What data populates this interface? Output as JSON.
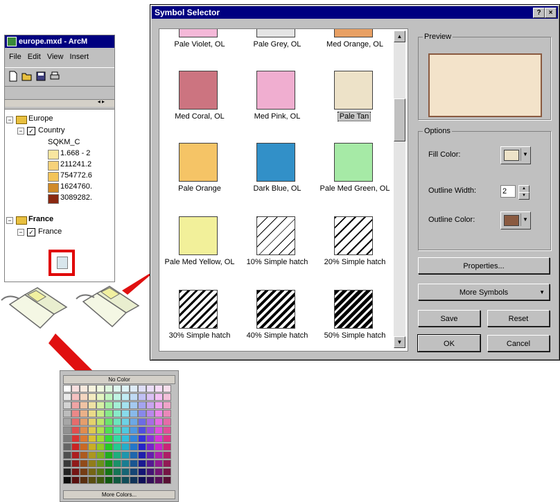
{
  "arcmap": {
    "title": "europe.mxd - ArcM",
    "menu": [
      "File",
      "Edit",
      "View",
      "Insert"
    ],
    "toc": {
      "group1": "Europe",
      "layer1": "Country",
      "field": "SQKM_C",
      "classes": [
        {
          "label": "1.668 - 2",
          "color": "#f9e6a0"
        },
        {
          "label": "211241.2",
          "color": "#f7d27a"
        },
        {
          "label": "754772.6",
          "color": "#f3c45a"
        },
        {
          "label": "1624760.",
          "color": "#d08a28"
        },
        {
          "label": "3089282.",
          "color": "#8a2810"
        }
      ],
      "group2": "France",
      "layer2": "France"
    }
  },
  "palette": {
    "top_label": "No Color",
    "bottom_label": "More Colors..."
  },
  "dialog": {
    "title": "Symbol Selector",
    "help_btn": "?",
    "close_btn": "×",
    "symbols": [
      {
        "label": "Pale Violet, OL",
        "color": "#f4b8d8"
      },
      {
        "label": "Pale Grey, OL",
        "color": "#e4e4e4"
      },
      {
        "label": "Med Orange, OL",
        "color": "#e8a064"
      },
      {
        "label": "Med Coral, OL",
        "color": "#cc7480"
      },
      {
        "label": "Med Pink, OL",
        "color": "#f0aed0"
      },
      {
        "label": "Pale Tan",
        "color": "#ede2c8"
      },
      {
        "label": "Pale Orange",
        "color": "#f5c466"
      },
      {
        "label": "Dark Blue, OL",
        "color": "#3290c8"
      },
      {
        "label": "Pale Med Green, OL",
        "color": "#a6eaa6"
      },
      {
        "label": "Pale Med Yellow, OL",
        "color": "#f2f09a"
      },
      {
        "label": "10% Simple hatch",
        "color": "hatch-10"
      },
      {
        "label": "20% Simple hatch",
        "color": "hatch-20"
      },
      {
        "label": "30% Simple hatch",
        "color": "hatch-30"
      },
      {
        "label": "40% Simple hatch",
        "color": "hatch-40"
      },
      {
        "label": "50% Simple hatch",
        "color": "hatch-50"
      }
    ],
    "preview_label": "Preview",
    "options_label": "Options",
    "fill_color_label": "Fill Color:",
    "outline_width_label": "Outline Width:",
    "outline_width_value": "2",
    "outline_color_label": "Outline Color:",
    "fill_color": "#ede2c8",
    "outline_color": "#8a5a40",
    "properties_btn": "Properties...",
    "more_symbols_btn": "More Symbols",
    "save_btn": "Save",
    "reset_btn": "Reset",
    "ok_btn": "OK",
    "cancel_btn": "Cancel"
  }
}
